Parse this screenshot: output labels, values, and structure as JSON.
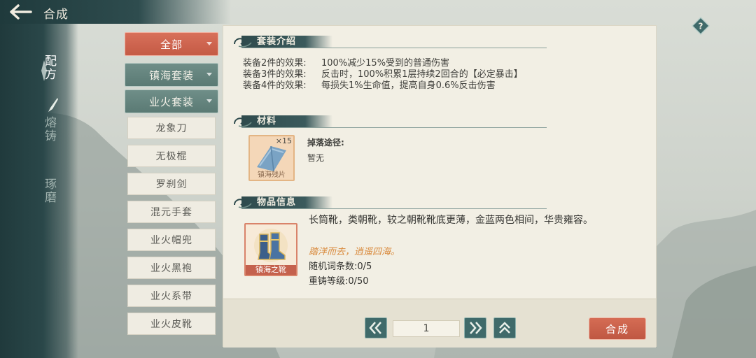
{
  "header": {
    "title": "合成"
  },
  "rail": {
    "tabs": [
      {
        "label": "配方",
        "active": true
      },
      {
        "label": "熔铸",
        "active": false
      },
      {
        "label": "琢磨",
        "active": false
      }
    ]
  },
  "categories": {
    "all_label": "全部",
    "sets": [
      "镇海套装",
      "业火套装"
    ],
    "items": [
      "龙象刀",
      "无极棍",
      "罗刹剑",
      "混元手套",
      "业火帽兜",
      "业火黑袍",
      "业火系带",
      "业火皮靴"
    ]
  },
  "set_intro": {
    "title": "套装介绍",
    "effects": [
      {
        "label": "装备2件的效果:",
        "text": "100%减少15%受到的普通伤害"
      },
      {
        "label": "装备3件的效果:",
        "text": "反击时，100%积累1层持续2回合的【必定暴击】"
      },
      {
        "label": "装备4件的效果:",
        "text": "每损失1%生命值，提高自身0.6%反击伤害"
      }
    ]
  },
  "materials": {
    "title": "材料",
    "item_name": "镇海残片",
    "count": "×15",
    "drop_label": "掉落途径:",
    "drop_value": "暂无"
  },
  "item_info": {
    "title": "物品信息",
    "name": "镇海之靴",
    "description": "长筒靴，类朝靴，较之朝靴靴底更薄，金蓝两色相间，华贵雍容。",
    "flavor": "踏洋而去，逍遥四海。",
    "random_affix": "随机词条数:0/5",
    "recast_level": "重铸等级:0/50"
  },
  "footer": {
    "page_value": "1",
    "craft_label": "合成"
  },
  "colors": {
    "accent_red": "#c45a45",
    "teal": "#3f6a6a",
    "flavor_orange": "#d98a3d"
  }
}
